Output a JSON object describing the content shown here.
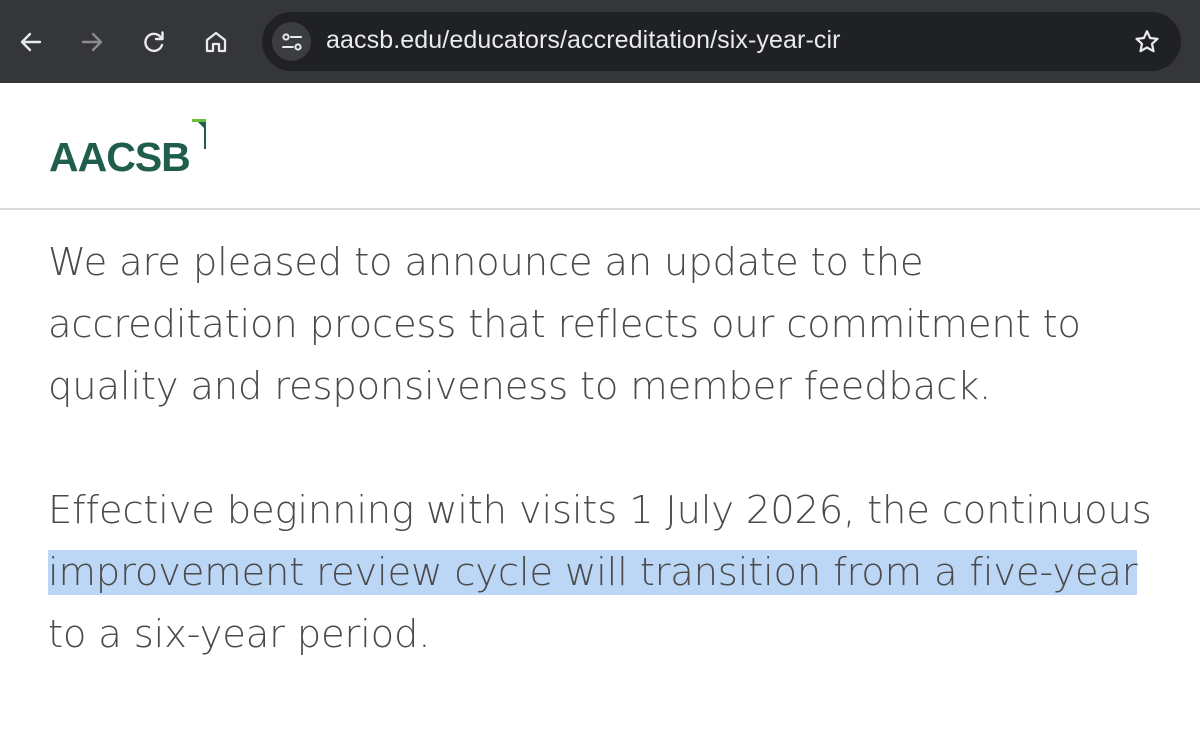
{
  "browser": {
    "url": "aacsb.edu/educators/accreditation/six-year-cir",
    "icons": {
      "back": "arrow-left-icon",
      "forward": "arrow-right-icon",
      "reload": "reload-icon",
      "home": "home-icon",
      "site_info": "tune-icon",
      "bookmark": "star-icon"
    },
    "colors": {
      "toolbar": "#35363a",
      "omnibox": "#202124",
      "text": "#e8eaed"
    }
  },
  "site": {
    "logo_text": "AACSB",
    "colors": {
      "brand_dark": "#1f5d4c",
      "brand_light": "#6cbf3c",
      "highlight": "#bcd7f6"
    }
  },
  "article": {
    "paragraph1": "We are pleased to announce an update to the accreditation process that reflects our commitment to quality and responsiveness to member feedback.",
    "paragraph2_part1": "Effective beginning with visits 1 July 2026, the continuous",
    "paragraph2_highlighted": "improvement review cycle will transition from a five-year",
    "paragraph2_part2": "to a six-year period."
  }
}
